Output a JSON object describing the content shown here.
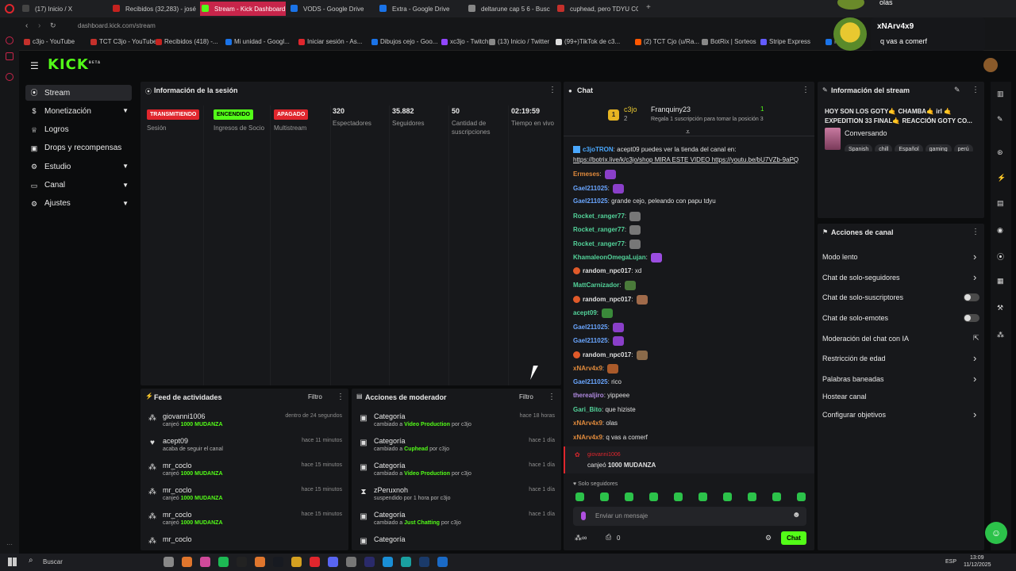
{
  "browser": {
    "tabs": [
      {
        "label": "(17) Inicio / X",
        "color": "#444444"
      },
      {
        "label": "Recibidos (32,283) - josé",
        "color": "#c5221f"
      },
      {
        "label": "Stream - Kick Dashboard",
        "color": "#53fc18",
        "active": true
      },
      {
        "label": "VODS - Google Drive",
        "color": "#1a73e8"
      },
      {
        "label": "Extra - Google Drive",
        "color": "#1a73e8"
      },
      {
        "label": "deltarune cap 5 6 - Busc",
        "color": "#888888"
      },
      {
        "label": "cuphead, pero TDYU CO",
        "color": "#c4302b"
      }
    ],
    "url": "dashboard.kick.com/stream",
    "bookmarks": [
      "c3jo - YouTube",
      "TCT C3jo - YouTube",
      "Recibidos (418) -...",
      "Mi unidad - Googl...",
      "Iniciar sesión - As...",
      "Dibujos cejo - Goo...",
      "xc3jo - Twitch",
      "(13) Inicio / Twitter",
      "(99+)TikTok de c3...",
      "(2) TCT Cjo (u/Ra...",
      "BotRix | Sorteos",
      "Stripe Express",
      "N"
    ]
  },
  "overlay": {
    "top_text": "olas",
    "username": "xNArv4x9",
    "message": "q vas a comerf"
  },
  "brand": {
    "logo": "KICK",
    "superscript": "BETA",
    "accent": "#53fc18"
  },
  "sidebar": {
    "items": [
      {
        "label": "Stream",
        "icon": "broadcast-icon",
        "active": true
      },
      {
        "label": "Monetización",
        "icon": "dollar-icon",
        "expand": true
      },
      {
        "label": "Logros",
        "icon": "trophy-icon"
      },
      {
        "label": "Drops y recompensas",
        "icon": "gift-icon"
      },
      {
        "label": "Estudio",
        "icon": "studio-icon",
        "expand": true
      },
      {
        "label": "Canal",
        "icon": "channel-icon",
        "expand": true
      },
      {
        "label": "Ajustes",
        "icon": "gear-icon",
        "expand": true
      }
    ]
  },
  "session": {
    "title": "Información de la sesión",
    "stats": [
      {
        "badge": "TRANSMITIENDO",
        "badge_color": "#e0262d",
        "label": "Sesión"
      },
      {
        "badge": "ENCENDIDO",
        "badge_color": "#53fc18",
        "label": "Ingresos de Socio"
      },
      {
        "badge": "APAGADO",
        "badge_color": "#e0262d",
        "label": "Multistream"
      },
      {
        "value": "320",
        "label": "Espectadores"
      },
      {
        "value": "35.882",
        "label": "Seguidores"
      },
      {
        "value": "50",
        "label": "Cantidad de suscripciones"
      },
      {
        "value": "02:19:59",
        "label": "Tiempo en vivo"
      }
    ]
  },
  "feed": {
    "title": "Feed de actividades",
    "filter": "Filtro",
    "rows": [
      {
        "user": "giovanni1006",
        "pre": "canjeó",
        "hl": "1000 MUDANZA",
        "time": "dentro de 24 segundos",
        "icon": "redeem-icon"
      },
      {
        "user": "acept09",
        "pre": "acaba de seguir el canal",
        "hl": "",
        "time": "hace 11 minutos",
        "icon": "heart-icon"
      },
      {
        "user": "mr_coclo",
        "pre": "canjeó",
        "hl": "1000 MUDANZA",
        "time": "hace 15 minutos",
        "icon": "redeem-icon"
      },
      {
        "user": "mr_coclo",
        "pre": "canjeó",
        "hl": "1000 MUDANZA",
        "time": "hace 15 minutos",
        "icon": "redeem-icon"
      },
      {
        "user": "mr_coclo",
        "pre": "canjeó",
        "hl": "1000 MUDANZA",
        "time": "hace 15 minutos",
        "icon": "redeem-icon"
      },
      {
        "user": "mr_coclo",
        "pre": "",
        "hl": "",
        "time": "",
        "icon": "redeem-icon"
      }
    ]
  },
  "mod": {
    "title": "Acciones de moderador",
    "filter": "Filtro",
    "rows": [
      {
        "user": "Categoría",
        "pre": "cambiado a",
        "hl": "Video Production",
        "post": "por c3jo",
        "time": "hace 18 horas",
        "icon": "category-icon"
      },
      {
        "user": "Categoría",
        "pre": "cambiado a",
        "hl": "Cuphead",
        "post": "por c3jo",
        "time": "hace 1 día",
        "icon": "category-icon"
      },
      {
        "user": "Categoría",
        "pre": "cambiado a",
        "hl": "Video Production",
        "post": "por c3jo",
        "time": "hace 1 día",
        "icon": "category-icon"
      },
      {
        "user": "zPeruxnoh",
        "pre": "suspendido por 1 hora por c3jo",
        "hl": "",
        "post": "",
        "time": "hace 1 día",
        "icon": "hourglass-icon"
      },
      {
        "user": "Categoría",
        "pre": "cambiado a",
        "hl": "Just Chatting",
        "post": "por c3jo",
        "time": "hace 1 día",
        "icon": "category-icon"
      },
      {
        "user": "Categoría",
        "pre": "",
        "hl": "",
        "post": "",
        "time": "",
        "icon": "category-icon"
      }
    ]
  },
  "chat": {
    "title": "Chat",
    "gifter_top": "c3jo",
    "gifter_count": "2",
    "gifter_rank": "1",
    "pinned_user": "Franquiny23",
    "pinned_rank": "1",
    "pinned_sub": "Regala 1 suscripción para tomar la posición 3",
    "messages": [
      {
        "user": "c3joTRON",
        "color": "#4aa8ff",
        "text": "acept09 puedes ver la tienda del canal en:",
        "bot": true
      },
      {
        "user": "",
        "color": "#e0e0e0",
        "text": "https://botrix.live/k/c3jo/shop MIRA ESTE VIDEO https://youtu.be/bU7VZb-9aPQ",
        "link": true
      },
      {
        "user": "Ermeses",
        "color": "#e08a3c",
        "text": "",
        "emote": "#8a3fc9"
      },
      {
        "user": "Gael211025",
        "color": "#6aa6ff",
        "text": "",
        "emote": "#8a3fc9"
      },
      {
        "user": "Gael211025",
        "color": "#6aa6ff",
        "text": "grande cejo, peleando con papu tdyu"
      },
      {
        "user": "Rocket_ranger77",
        "color": "#53d39a",
        "text": "",
        "emote": "#777777"
      },
      {
        "user": "Rocket_ranger77",
        "color": "#53d39a",
        "text": "",
        "emote": "#777777"
      },
      {
        "user": "Rocket_ranger77",
        "color": "#53d39a",
        "text": "",
        "emote": "#777777"
      },
      {
        "user": "KhamaleonOmegaLujan",
        "color": "#53d39a",
        "text": "",
        "emote": "#9b4de0"
      },
      {
        "user": "random_npc017",
        "color": "#e0e0e0",
        "text": "xd",
        "badge": true
      },
      {
        "user": "MattCarnizador",
        "color": "#53d39a",
        "text": "",
        "emote": "#4a7a3a"
      },
      {
        "user": "random_npc017",
        "color": "#e0e0e0",
        "text": "",
        "badge": true,
        "emote": "#a06a4a"
      },
      {
        "user": "acept09",
        "color": "#53d39a",
        "text": "",
        "emote": "#3a8a3a"
      },
      {
        "user": "Gael211025",
        "color": "#6aa6ff",
        "text": "",
        "emote": "#8a3fc9"
      },
      {
        "user": "Gael211025",
        "color": "#6aa6ff",
        "text": "",
        "emote": "#8a3fc9"
      },
      {
        "user": "random_npc017",
        "color": "#e0e0e0",
        "text": "",
        "badge": true,
        "emote": "#8a6a4a"
      },
      {
        "user": "xNArv4x9",
        "color": "#e08a3c",
        "text": "",
        "emote": "#aa5a2a"
      },
      {
        "user": "Gael211025",
        "color": "#6aa6ff",
        "text": "rico"
      },
      {
        "user": "therealjiro",
        "color": "#b08ae0",
        "text": "yippeee"
      },
      {
        "user": "Gari_Bito",
        "color": "#53d39a",
        "text": "que hiziste"
      },
      {
        "user": "xNArv4x9",
        "color": "#e08a3c",
        "text": "olas"
      },
      {
        "user": "xNArv4x9",
        "color": "#e08a3c",
        "text": "q vas a comerf"
      }
    ],
    "redeem_user": "giovanni1006",
    "redeem_text": "canjeó",
    "redeem_hl": "1000 MUDANZA",
    "followers_only": "Solo seguidores",
    "input_placeholder": "Enviar un mensaje",
    "points": "0",
    "send": "Chat"
  },
  "stream_info": {
    "title": "Información del stream",
    "stream_title": "HOY SON LOS GOTY🤙 CHAMBA🤙 irl 🤙 EXPEDITION 33 FINAL🤙 REACCIÓN GOTY CO...",
    "category": "Conversando",
    "tags": [
      "Spanish",
      "chill",
      "Español",
      "gaming",
      "perú"
    ]
  },
  "channel_actions": {
    "title": "Acciones de canal",
    "items": [
      {
        "label": "Modo lento",
        "control": "chevron"
      },
      {
        "label": "Chat de solo-seguidores",
        "control": "chevron"
      },
      {
        "label": "Chat de solo-suscriptores",
        "control": "toggle"
      },
      {
        "label": "Chat de solo-emotes",
        "control": "toggle"
      },
      {
        "label": "Moderación del chat con IA",
        "control": "external"
      },
      {
        "label": "Restricción de edad",
        "control": "chevron"
      },
      {
        "label": "Palabras baneadas",
        "control": "chevron"
      },
      {
        "label": "Hostear canal",
        "control": "none"
      },
      {
        "label": "Configurar objetivos",
        "control": "chevron"
      }
    ]
  },
  "taskbar": {
    "search": "Buscar",
    "lang": "ESP",
    "time": "13:09",
    "date": "11/12/2025"
  }
}
